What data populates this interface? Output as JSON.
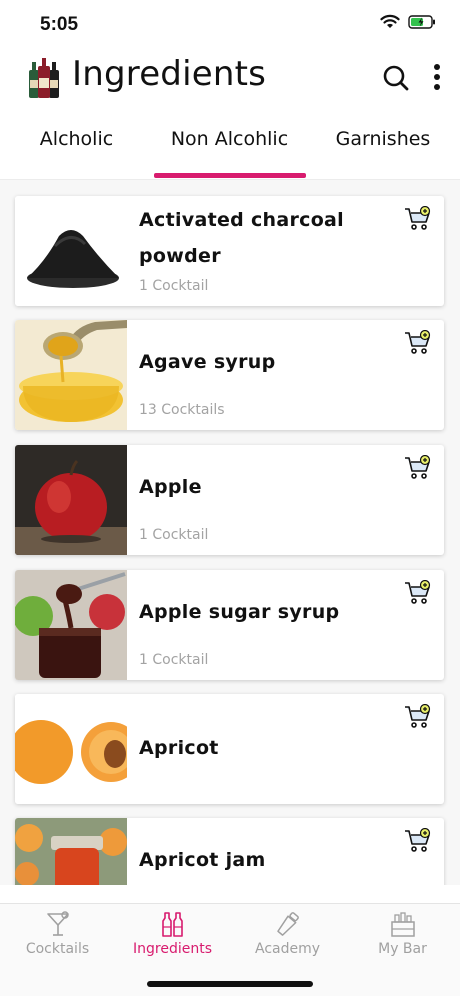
{
  "status": {
    "time": "5:05"
  },
  "header": {
    "title": "Ingredients"
  },
  "tabs": [
    {
      "label": "Alcholic"
    },
    {
      "label": "Non Alcohlic"
    },
    {
      "label": "Garnishes"
    }
  ],
  "items": [
    {
      "name": "Activated charcoal powder",
      "count": "1 Cocktail"
    },
    {
      "name": "Agave syrup",
      "count": "13 Cocktails"
    },
    {
      "name": "Apple",
      "count": "1 Cocktail"
    },
    {
      "name": "Apple sugar syrup",
      "count": "1 Cocktail"
    },
    {
      "name": "Apricot",
      "count": ""
    },
    {
      "name": "Apricot jam",
      "count": ""
    }
  ],
  "nav": [
    {
      "label": "Cocktails"
    },
    {
      "label": "Ingredients"
    },
    {
      "label": "Academy"
    },
    {
      "label": "My Bar"
    }
  ],
  "colors": {
    "accent": "#d81b6e",
    "inactive": "#a0a0a0"
  }
}
